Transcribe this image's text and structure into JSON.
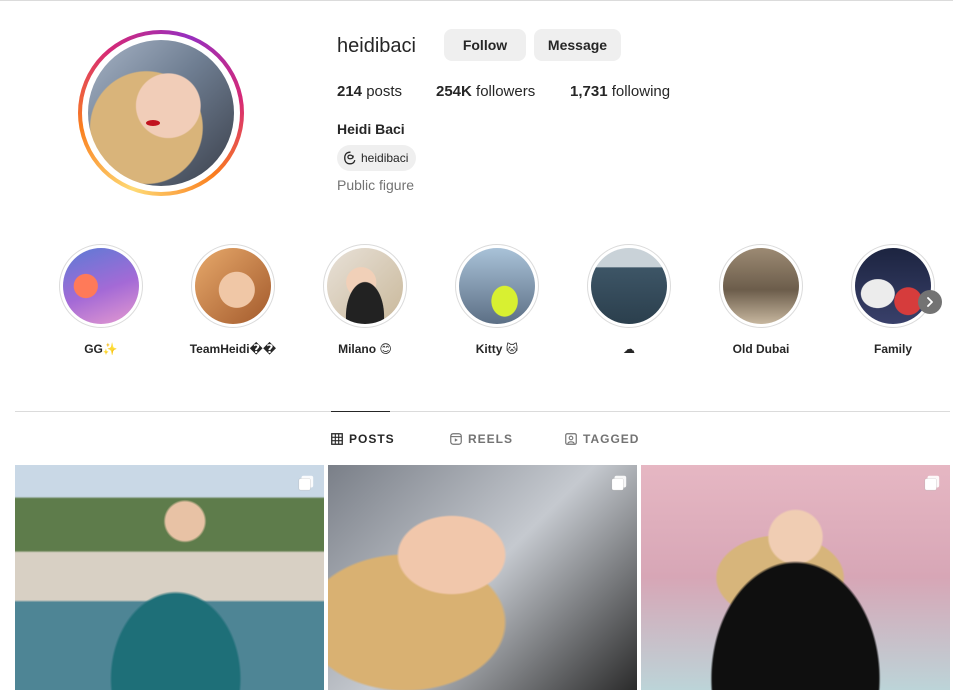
{
  "profile": {
    "username": "heidibaci",
    "follow_label": "Follow",
    "message_label": "Message",
    "stats": {
      "posts_count": "214",
      "posts_label": "posts",
      "followers_count": "254K",
      "followers_label": "followers",
      "following_count": "1,731",
      "following_label": "following"
    },
    "full_name": "Heidi Baci",
    "threads_handle": "heidibaci",
    "category": "Public figure"
  },
  "highlights": [
    {
      "label": "GG✨",
      "icon": "highlight-gg"
    },
    {
      "label": "TeamHeidi��",
      "icon": "highlight-teamheidi"
    },
    {
      "label": "Milano 😊",
      "icon": "highlight-milano"
    },
    {
      "label": "Kitty 🐱",
      "icon": "highlight-kitty"
    },
    {
      "label": "☁",
      "icon": "highlight-cloud"
    },
    {
      "label": "Old Dubai",
      "icon": "highlight-old-dubai"
    },
    {
      "label": "Family",
      "icon": "highlight-family"
    }
  ],
  "tabs": {
    "posts": "POSTS",
    "reels": "REELS",
    "tagged": "TAGGED"
  },
  "colors": {
    "button_bg": "#efefef",
    "text_primary": "#262626",
    "text_secondary": "#737373",
    "divider": "#dbdbdb"
  }
}
